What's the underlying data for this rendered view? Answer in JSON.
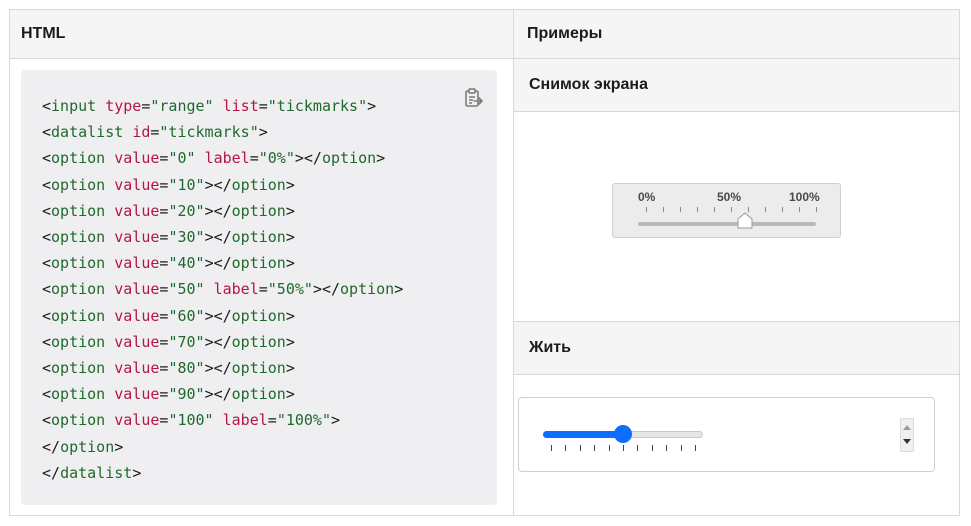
{
  "header": {
    "col_html": "HTML",
    "col_examples": "Примеры"
  },
  "code_lines": [
    [
      {
        "t": "tk",
        "s": "<"
      },
      {
        "t": "tn",
        "s": "input"
      },
      {
        "t": "tk",
        "s": " "
      },
      {
        "t": "at",
        "s": "type"
      },
      {
        "t": "tk",
        "s": "="
      },
      {
        "t": "st",
        "s": "\"range\""
      },
      {
        "t": "tk",
        "s": " "
      },
      {
        "t": "at",
        "s": "list"
      },
      {
        "t": "tk",
        "s": "="
      },
      {
        "t": "st",
        "s": "\"tickmarks\""
      },
      {
        "t": "tk",
        "s": ">"
      }
    ],
    [
      {
        "t": "tk",
        "s": "<"
      },
      {
        "t": "tn",
        "s": "datalist"
      },
      {
        "t": "tk",
        "s": " "
      },
      {
        "t": "at",
        "s": "id"
      },
      {
        "t": "tk",
        "s": "="
      },
      {
        "t": "st",
        "s": "\"tickmarks\""
      },
      {
        "t": "tk",
        "s": ">"
      }
    ],
    [
      {
        "t": "tk",
        "s": "<"
      },
      {
        "t": "tn",
        "s": "option"
      },
      {
        "t": "tk",
        "s": " "
      },
      {
        "t": "at",
        "s": "value"
      },
      {
        "t": "tk",
        "s": "="
      },
      {
        "t": "st",
        "s": "\"0\""
      },
      {
        "t": "tk",
        "s": " "
      },
      {
        "t": "at",
        "s": "label"
      },
      {
        "t": "tk",
        "s": "="
      },
      {
        "t": "st",
        "s": "\"0%\""
      },
      {
        "t": "tk",
        "s": "></"
      },
      {
        "t": "tn",
        "s": "option"
      },
      {
        "t": "tk",
        "s": ">"
      }
    ],
    [
      {
        "t": "tk",
        "s": "<"
      },
      {
        "t": "tn",
        "s": "option"
      },
      {
        "t": "tk",
        "s": " "
      },
      {
        "t": "at",
        "s": "value"
      },
      {
        "t": "tk",
        "s": "="
      },
      {
        "t": "st",
        "s": "\"10\""
      },
      {
        "t": "tk",
        "s": "></"
      },
      {
        "t": "tn",
        "s": "option"
      },
      {
        "t": "tk",
        "s": ">"
      }
    ],
    [
      {
        "t": "tk",
        "s": "<"
      },
      {
        "t": "tn",
        "s": "option"
      },
      {
        "t": "tk",
        "s": " "
      },
      {
        "t": "at",
        "s": "value"
      },
      {
        "t": "tk",
        "s": "="
      },
      {
        "t": "st",
        "s": "\"20\""
      },
      {
        "t": "tk",
        "s": "></"
      },
      {
        "t": "tn",
        "s": "option"
      },
      {
        "t": "tk",
        "s": ">"
      }
    ],
    [
      {
        "t": "tk",
        "s": "<"
      },
      {
        "t": "tn",
        "s": "option"
      },
      {
        "t": "tk",
        "s": " "
      },
      {
        "t": "at",
        "s": "value"
      },
      {
        "t": "tk",
        "s": "="
      },
      {
        "t": "st",
        "s": "\"30\""
      },
      {
        "t": "tk",
        "s": "></"
      },
      {
        "t": "tn",
        "s": "option"
      },
      {
        "t": "tk",
        "s": ">"
      }
    ],
    [
      {
        "t": "tk",
        "s": "<"
      },
      {
        "t": "tn",
        "s": "option"
      },
      {
        "t": "tk",
        "s": " "
      },
      {
        "t": "at",
        "s": "value"
      },
      {
        "t": "tk",
        "s": "="
      },
      {
        "t": "st",
        "s": "\"40\""
      },
      {
        "t": "tk",
        "s": "></"
      },
      {
        "t": "tn",
        "s": "option"
      },
      {
        "t": "tk",
        "s": ">"
      }
    ],
    [
      {
        "t": "tk",
        "s": "<"
      },
      {
        "t": "tn",
        "s": "option"
      },
      {
        "t": "tk",
        "s": " "
      },
      {
        "t": "at",
        "s": "value"
      },
      {
        "t": "tk",
        "s": "="
      },
      {
        "t": "st",
        "s": "\"50\""
      },
      {
        "t": "tk",
        "s": " "
      },
      {
        "t": "at",
        "s": "label"
      },
      {
        "t": "tk",
        "s": "="
      },
      {
        "t": "st",
        "s": "\"50%\""
      },
      {
        "t": "tk",
        "s": "></"
      },
      {
        "t": "tn",
        "s": "option"
      },
      {
        "t": "tk",
        "s": ">"
      }
    ],
    [
      {
        "t": "tk",
        "s": "<"
      },
      {
        "t": "tn",
        "s": "option"
      },
      {
        "t": "tk",
        "s": " "
      },
      {
        "t": "at",
        "s": "value"
      },
      {
        "t": "tk",
        "s": "="
      },
      {
        "t": "st",
        "s": "\"60\""
      },
      {
        "t": "tk",
        "s": "></"
      },
      {
        "t": "tn",
        "s": "option"
      },
      {
        "t": "tk",
        "s": ">"
      }
    ],
    [
      {
        "t": "tk",
        "s": "<"
      },
      {
        "t": "tn",
        "s": "option"
      },
      {
        "t": "tk",
        "s": " "
      },
      {
        "t": "at",
        "s": "value"
      },
      {
        "t": "tk",
        "s": "="
      },
      {
        "t": "st",
        "s": "\"70\""
      },
      {
        "t": "tk",
        "s": "></"
      },
      {
        "t": "tn",
        "s": "option"
      },
      {
        "t": "tk",
        "s": ">"
      }
    ],
    [
      {
        "t": "tk",
        "s": "<"
      },
      {
        "t": "tn",
        "s": "option"
      },
      {
        "t": "tk",
        "s": " "
      },
      {
        "t": "at",
        "s": "value"
      },
      {
        "t": "tk",
        "s": "="
      },
      {
        "t": "st",
        "s": "\"80\""
      },
      {
        "t": "tk",
        "s": "></"
      },
      {
        "t": "tn",
        "s": "option"
      },
      {
        "t": "tk",
        "s": ">"
      }
    ],
    [
      {
        "t": "tk",
        "s": "<"
      },
      {
        "t": "tn",
        "s": "option"
      },
      {
        "t": "tk",
        "s": " "
      },
      {
        "t": "at",
        "s": "value"
      },
      {
        "t": "tk",
        "s": "="
      },
      {
        "t": "st",
        "s": "\"90\""
      },
      {
        "t": "tk",
        "s": "></"
      },
      {
        "t": "tn",
        "s": "option"
      },
      {
        "t": "tk",
        "s": ">"
      }
    ],
    [
      {
        "t": "tk",
        "s": "<"
      },
      {
        "t": "tn",
        "s": "option"
      },
      {
        "t": "tk",
        "s": " "
      },
      {
        "t": "at",
        "s": "value"
      },
      {
        "t": "tk",
        "s": "="
      },
      {
        "t": "st",
        "s": "\"100\""
      },
      {
        "t": "tk",
        "s": " "
      },
      {
        "t": "at",
        "s": "label"
      },
      {
        "t": "tk",
        "s": "="
      },
      {
        "t": "st",
        "s": "\"100%\""
      },
      {
        "t": "tk",
        "s": ">"
      }
    ],
    [
      {
        "t": "tk",
        "s": "</"
      },
      {
        "t": "tn",
        "s": "option"
      },
      {
        "t": "tk",
        "s": ">"
      }
    ],
    [
      {
        "t": "tk",
        "s": "</"
      },
      {
        "t": "tn",
        "s": "datalist"
      },
      {
        "t": "tk",
        "s": ">"
      }
    ]
  ],
  "examples": {
    "screenshot_title": "Снимок экрана",
    "live_title": "Жить",
    "screenshot_labels": [
      "0%",
      "50%",
      "100%"
    ],
    "tick_count": 11,
    "screenshot_value_fraction": 0.6,
    "live_value_fraction": 0.5
  },
  "icons": {
    "copy": "clipboard-copy-icon"
  },
  "colors": {
    "accent": "#0d6efd",
    "tag": "#1f6a2a",
    "attr": "#b3154a",
    "string": "#1f6a2a"
  }
}
